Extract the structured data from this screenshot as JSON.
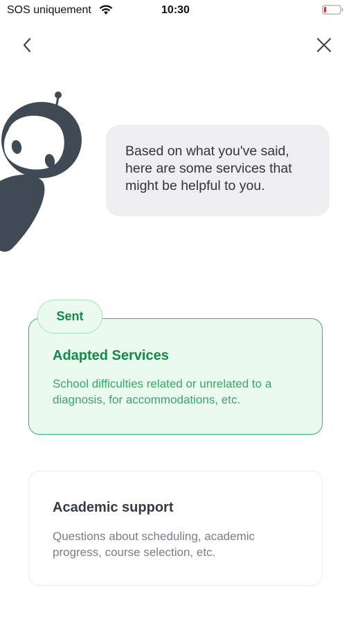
{
  "status_bar": {
    "carrier": "SOS uniquement",
    "time": "10:30",
    "battery_color": "#e0312a"
  },
  "nav": {
    "back_icon": "chevron-left-icon",
    "close_icon": "close-icon"
  },
  "bot": {
    "color": "#3f4a55"
  },
  "message": {
    "text": "Based on what you've said, here are some services that might be helpful to you."
  },
  "services": [
    {
      "badge": "Sent",
      "title": "Adapted Services",
      "description": "School difficulties related or unrelated to a diagnosis, for accommodations, etc.",
      "selected": true
    },
    {
      "title": "Academic support",
      "description": "Questions about scheduling, academic progress, course selection, etc.",
      "selected": false
    }
  ],
  "colors": {
    "accent_green": "#128a48",
    "selected_bg": "#eafaef",
    "selected_border": "#3cae6c",
    "bubble_bg": "#efeff1"
  }
}
